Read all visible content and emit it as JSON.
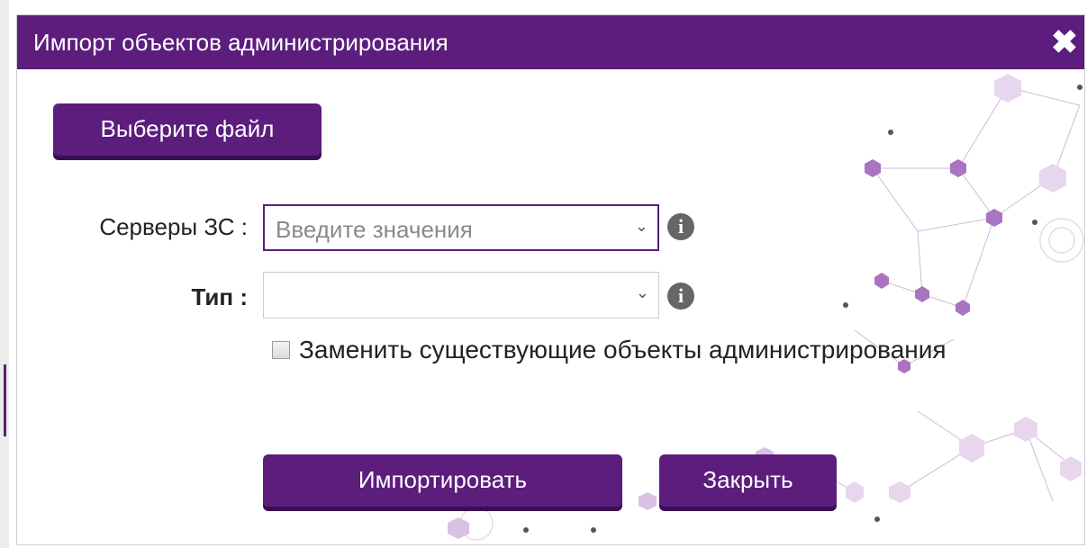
{
  "dialog": {
    "title": "Импорт объектов администрирования",
    "close_icon": "close-icon",
    "choose_file_label": "Выберите файл",
    "servers": {
      "label": "Серверы ЗС :",
      "placeholder": "Введите значения",
      "info_icon": "info-icon"
    },
    "type": {
      "label": "Тип :",
      "value": "",
      "info_icon": "info-icon"
    },
    "replace_checkbox": {
      "label": "Заменить существующие объекты администрирования",
      "checked": false
    },
    "import_label": "Импортировать",
    "close_label": "Закрыть"
  },
  "colors": {
    "accent": "#5c1d7d",
    "accent_shadow": "#3a0f52"
  }
}
